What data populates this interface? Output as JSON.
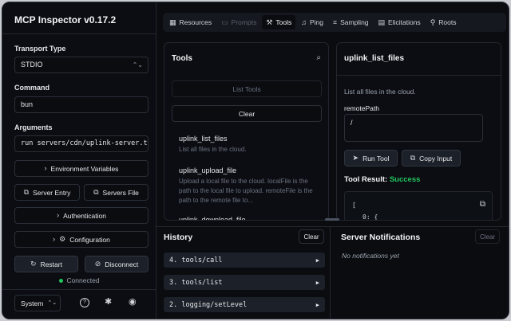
{
  "app": {
    "title": "MCP Inspector v0.17.2"
  },
  "sidebar": {
    "transport_label": "Transport Type",
    "transport_value": "STDIO",
    "command_label": "Command",
    "command_value": "bun",
    "arguments_label": "Arguments",
    "arguments_value": "run servers/cdn/uplink-server.t",
    "env_vars_label": "Environment Variables",
    "server_entry_label": "Server Entry",
    "servers_file_label": "Servers File",
    "authentication_label": "Authentication",
    "configuration_label": "Configuration",
    "restart_label": "Restart",
    "disconnect_label": "Disconnect",
    "status_text": "Connected",
    "status_color": "#22c55e",
    "theme_value": "System"
  },
  "tabs": [
    {
      "label": "Resources",
      "icon": "resources-icon"
    },
    {
      "label": "Prompts",
      "icon": "prompts-icon"
    },
    {
      "label": "Tools",
      "icon": "tools-icon"
    },
    {
      "label": "Ping",
      "icon": "ping-icon"
    },
    {
      "label": "Sampling",
      "icon": "sampling-icon"
    },
    {
      "label": "Elicitations",
      "icon": "elicitations-icon"
    },
    {
      "label": "Roots",
      "icon": "roots-icon"
    }
  ],
  "tools_panel": {
    "title": "Tools",
    "list_tools_label": "List Tools",
    "clear_label": "Clear",
    "items": [
      {
        "name": "uplink_list_files",
        "description": "List all files in the cloud."
      },
      {
        "name": "uplink_upload_file",
        "description": "Upload a local file to the cloud. localFile is the path to the local file to upload. remoteFile is the path to the remote file to..."
      },
      {
        "name": "uplink_download_file",
        "description": ""
      }
    ]
  },
  "tool_detail": {
    "title": "uplink_list_files",
    "description": "List all files in the cloud.",
    "param_label": "remotePath",
    "param_value": "/",
    "run_label": "Run Tool",
    "copy_label": "Copy Input",
    "result_label": "Tool Result:",
    "result_status": "Success",
    "result_lines": [
      "[",
      "0: {"
    ]
  },
  "history": {
    "title": "History",
    "clear_label": "Clear",
    "items": [
      "4. tools/call",
      "3. tools/list",
      "2. logging/setLevel"
    ]
  },
  "notifications": {
    "title": "Server Notifications",
    "clear_label": "Clear",
    "empty_text": "No notifications yet"
  }
}
